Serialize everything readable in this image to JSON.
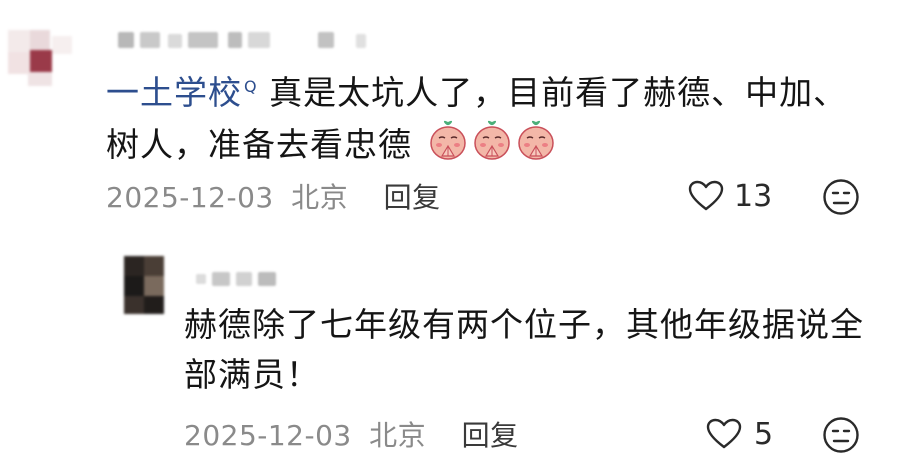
{
  "comments": [
    {
      "author_link": "一土学校",
      "search_glyph": "Q",
      "text_line1": "真是太坑人了，目前看了赫德、中加、",
      "text_line2": "树人，准备去看忠德",
      "emojis": [
        "peach-pray-emoji",
        "peach-pray-emoji",
        "peach-pray-emoji"
      ],
      "date": "2025-12-03",
      "location": "北京",
      "reply_label": "回复",
      "likes": "13"
    },
    {
      "text_line1": "赫德除了七年级有两个位子，其他年级据说全",
      "text_line2": "部满员！",
      "date": "2025-12-03",
      "location": "北京",
      "reply_label": "回复",
      "likes": "5"
    }
  ],
  "icons": {
    "like": "heart-outline-icon",
    "dislike": "meh-face-icon"
  },
  "colors": {
    "link": "#2d4e8e",
    "meta": "#8a8a8a",
    "text": "#151515",
    "background": "#ffffff"
  }
}
